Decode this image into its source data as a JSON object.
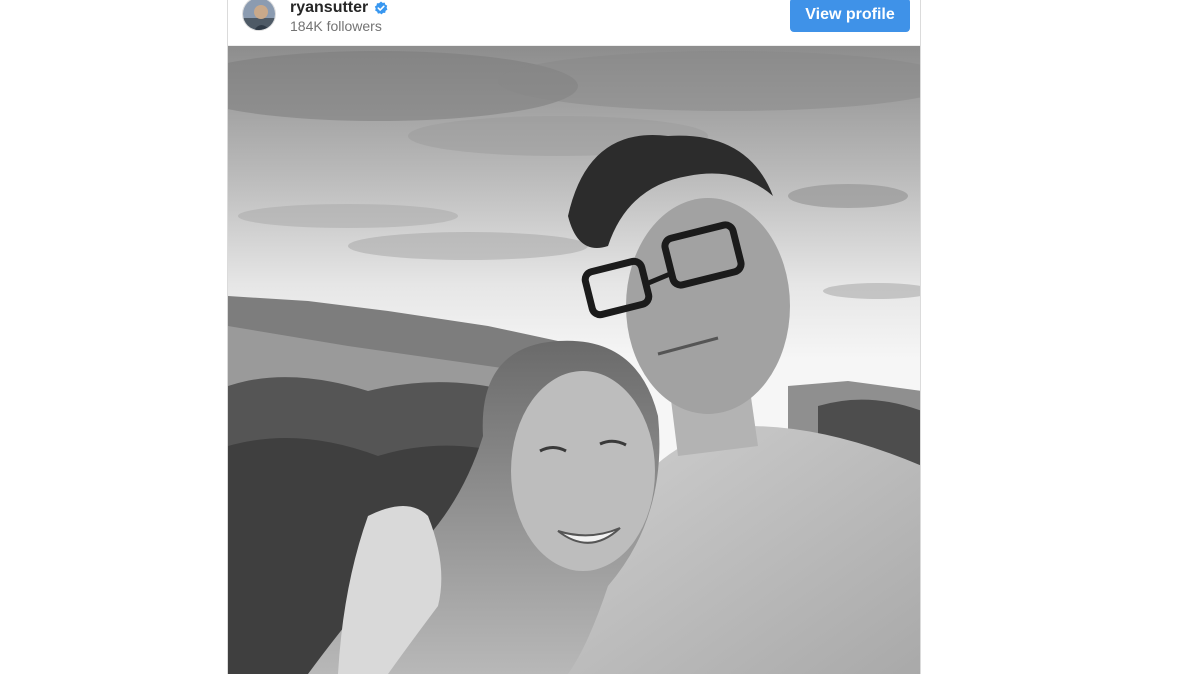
{
  "post": {
    "username": "ryansutter",
    "verified": true,
    "followers": "184K followers",
    "view_profile_label": "View profile"
  },
  "icons": {
    "verified_badge": "verified-check-badge",
    "verified_color": "#3897f0"
  },
  "colors": {
    "button_bg": "#3f92e8",
    "button_text": "#ffffff",
    "username_text": "#262626",
    "followers_text": "#737373"
  }
}
